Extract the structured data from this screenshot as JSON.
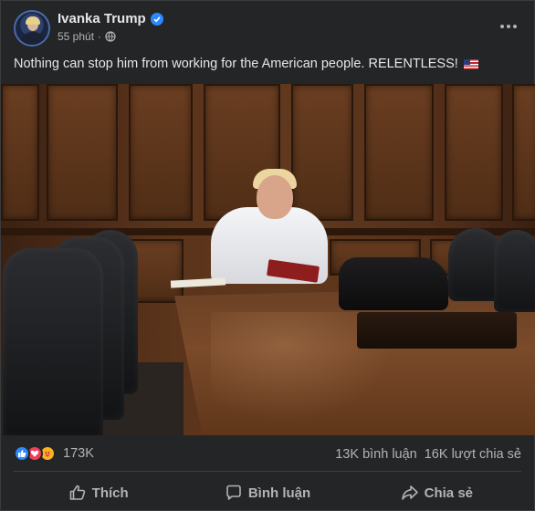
{
  "post": {
    "author": "Ivanka Trump",
    "timestamp": "55 phút",
    "privacy_icon": "globe-icon",
    "text": "Nothing can stop him from working for the American people. RELENTLESS!",
    "emoji": "us-flag"
  },
  "reactions": {
    "types": [
      "like",
      "love",
      "care"
    ],
    "count": "173K",
    "comments": "13K bình luận",
    "shares": "16K lượt chia sẻ"
  },
  "actions": {
    "like_label": "Thích",
    "comment_label": "Bình luận",
    "share_label": "Chia sẻ"
  },
  "colors": {
    "background": "#242526",
    "text": "#e4e6eb",
    "muted": "#b0b3b8",
    "accent": "#2d88ff"
  }
}
